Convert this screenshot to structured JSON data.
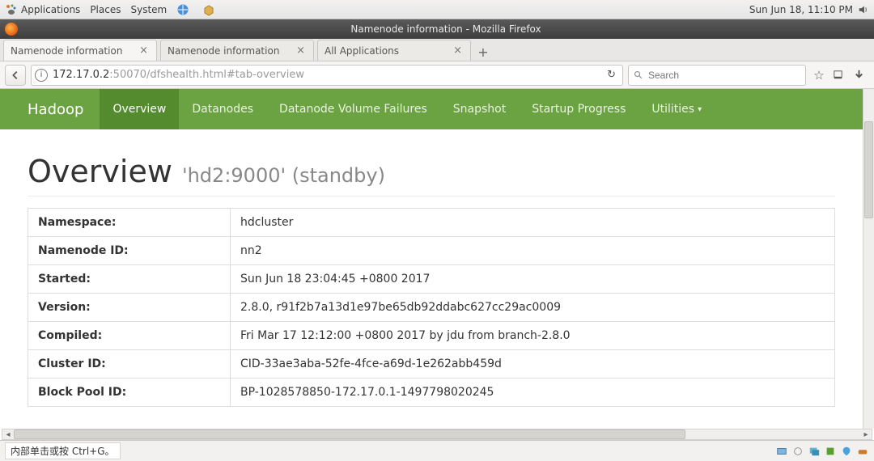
{
  "panel": {
    "menus": [
      "Applications",
      "Places",
      "System"
    ],
    "clock": "Sun Jun 18, 11:10 PM"
  },
  "firefox": {
    "window_title": "Namenode information - Mozilla Firefox",
    "tabs": [
      {
        "label": "Namenode information"
      },
      {
        "label": "Namenode information"
      },
      {
        "label": "All Applications"
      }
    ],
    "url_prefix": "172.17.0.2",
    "url_suffix": ":50070/dfshealth.html#tab-overview",
    "search_placeholder": "Search"
  },
  "hadoop": {
    "brand": "Hadoop",
    "nav": [
      "Overview",
      "Datanodes",
      "Datanode Volume Failures",
      "Snapshot",
      "Startup Progress",
      "Utilities"
    ]
  },
  "overview": {
    "heading": "Overview",
    "subheading": "'hd2:9000' (standby)",
    "rows": [
      {
        "k": "Namespace:",
        "v": "hdcluster"
      },
      {
        "k": "Namenode ID:",
        "v": "nn2"
      },
      {
        "k": "Started:",
        "v": "Sun Jun 18 23:04:45 +0800 2017"
      },
      {
        "k": "Version:",
        "v": "2.8.0, r91f2b7a13d1e97be65db92ddabc627cc29ac0009"
      },
      {
        "k": "Compiled:",
        "v": "Fri Mar 17 12:12:00 +0800 2017 by jdu from branch-2.8.0"
      },
      {
        "k": "Cluster ID:",
        "v": "CID-33ae3aba-52fe-4fce-a69d-1e262abb459d"
      },
      {
        "k": "Block Pool ID:",
        "v": "BP-1028578850-172.17.0.1-1497798020245"
      }
    ]
  },
  "status": {
    "message": "内部单击或按 Ctrl+G。"
  }
}
